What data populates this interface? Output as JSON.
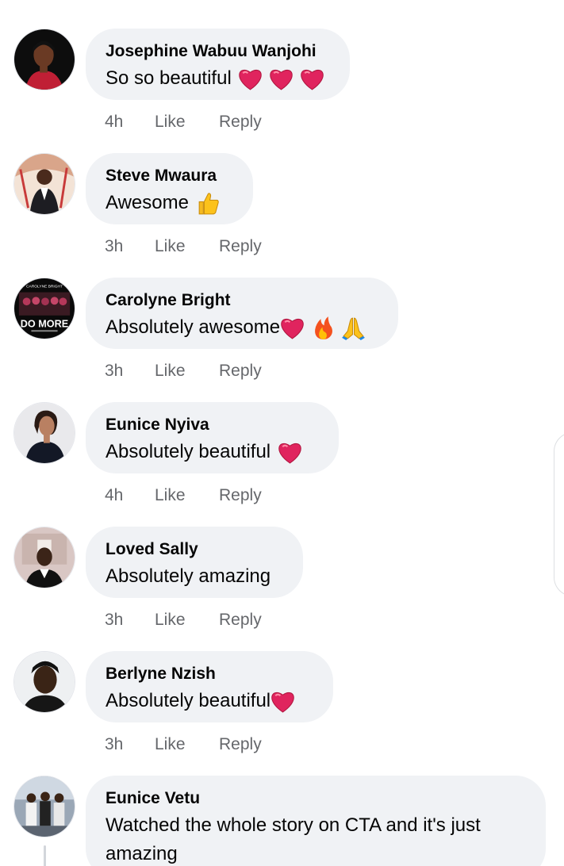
{
  "comments": [
    {
      "author": "Josephine Wabuu Wanjohi",
      "text": "So so beautiful",
      "emojis": [
        "heart-icon",
        "heart-icon",
        "heart-icon"
      ],
      "time": "4h",
      "like_label": "Like",
      "reply_label": "Reply"
    },
    {
      "author": "Steve Mwaura",
      "text": "Awesome",
      "emojis": [
        "thumbs-up-icon"
      ],
      "time": "3h",
      "like_label": "Like",
      "reply_label": "Reply"
    },
    {
      "author": "Carolyne Bright",
      "text": "Absolutely awesome",
      "emojis": [
        "heart-icon",
        "fire-icon",
        "folded-hands-icon"
      ],
      "time": "3h",
      "like_label": "Like",
      "reply_label": "Reply",
      "avatar_caption_top": "CAROLYNE BRIGHT",
      "avatar_caption_main": "DO MORE"
    },
    {
      "author": "Eunice Nyiva",
      "text": "Absolutely beautiful",
      "emojis": [
        "heart-icon"
      ],
      "time": "4h",
      "like_label": "Like",
      "reply_label": "Reply"
    },
    {
      "author": "Loved Sally",
      "text": "Absolutely amazing",
      "emojis": [],
      "time": "3h",
      "like_label": "Like",
      "reply_label": "Reply"
    },
    {
      "author": "Berlyne Nzish",
      "text": "Absolutely beautiful",
      "emojis": [
        "heart-icon"
      ],
      "time": "3h",
      "like_label": "Like",
      "reply_label": "Reply"
    },
    {
      "author": "Eunice Vetu",
      "text": "Watched the whole story on CTA and it's just amazing",
      "emojis": [],
      "time": "",
      "like_label": "",
      "reply_label": ""
    }
  ],
  "colors": {
    "bubble": "#f0f2f5",
    "meta_text": "#65676b",
    "heart": "#e0245e"
  }
}
